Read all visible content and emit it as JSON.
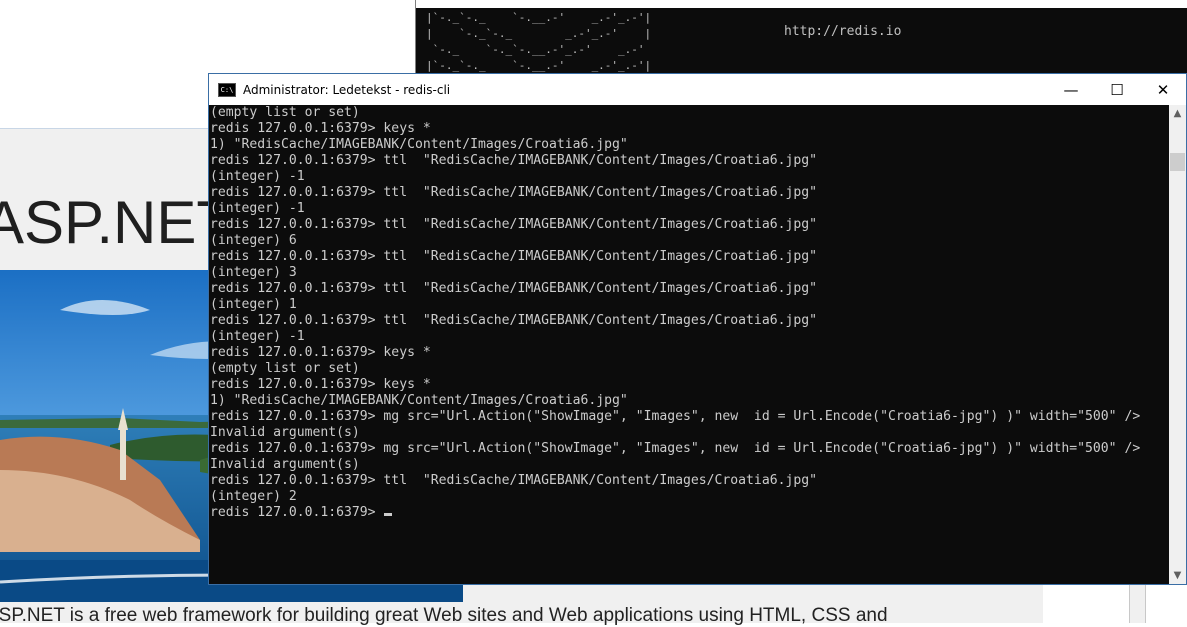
{
  "browser_page": {
    "heading": "ASP.NET",
    "description": "ASP.NET is a free web framework for building great Web sites and Web applications using HTML, CSS and"
  },
  "server_console": {
    "url": "http://redis.io"
  },
  "console_window": {
    "title": "Administrator: Ledetekst - redis-cli",
    "controls": {
      "minimize": "—",
      "maximize": "☐",
      "close": "✕"
    },
    "lines": [
      "(empty list or set)",
      "redis 127.0.0.1:6379> keys *",
      "1) \"RedisCache/IMAGEBANK/Content/Images/Croatia6.jpg\"",
      "redis 127.0.0.1:6379> ttl  \"RedisCache/IMAGEBANK/Content/Images/Croatia6.jpg\"",
      "(integer) -1",
      "redis 127.0.0.1:6379> ttl  \"RedisCache/IMAGEBANK/Content/Images/Croatia6.jpg\"",
      "(integer) -1",
      "redis 127.0.0.1:6379> ttl  \"RedisCache/IMAGEBANK/Content/Images/Croatia6.jpg\"",
      "(integer) 6",
      "redis 127.0.0.1:6379> ttl  \"RedisCache/IMAGEBANK/Content/Images/Croatia6.jpg\"",
      "(integer) 3",
      "redis 127.0.0.1:6379> ttl  \"RedisCache/IMAGEBANK/Content/Images/Croatia6.jpg\"",
      "(integer) 1",
      "redis 127.0.0.1:6379> ttl  \"RedisCache/IMAGEBANK/Content/Images/Croatia6.jpg\"",
      "(integer) -1",
      "redis 127.0.0.1:6379> keys *",
      "(empty list or set)",
      "redis 127.0.0.1:6379> keys *",
      "1) \"RedisCache/IMAGEBANK/Content/Images/Croatia6.jpg\"",
      "redis 127.0.0.1:6379> mg src=\"Url.Action(\"ShowImage\", \"Images\", new  id = Url.Encode(\"Croatia6-jpg\") )\" width=\"500\" />",
      "Invalid argument(s)",
      "redis 127.0.0.1:6379> mg src=\"Url.Action(\"ShowImage\", \"Images\", new  id = Url.Encode(\"Croatia6-jpg\") )\" width=\"500\" />",
      "Invalid argument(s)",
      "redis 127.0.0.1:6379> ttl  \"RedisCache/IMAGEBANK/Content/Images/Croatia6.jpg\"",
      "(integer) 2"
    ],
    "prompt": "redis 127.0.0.1:6379> "
  },
  "colors": {
    "console_bg": "#0c0c0c",
    "console_text": "#cccccc",
    "window_border": "#3a6ea5",
    "page_bg": "#f0f0f0"
  },
  "icons": [
    "cmd-app-icon",
    "minimize-icon",
    "maximize-icon",
    "close-icon",
    "scroll-up-icon",
    "scroll-down-icon"
  ]
}
